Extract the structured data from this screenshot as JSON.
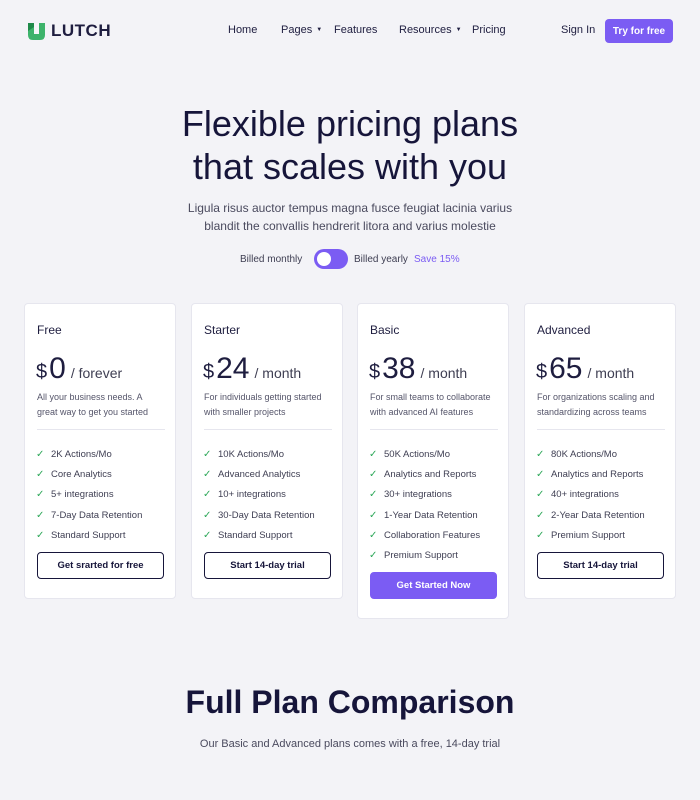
{
  "brand": {
    "name": "LUTCH",
    "logo_icon": "lutch-logo-icon",
    "accent_color": "#7b5cf3"
  },
  "nav": {
    "links": [
      {
        "label": "Home",
        "has_dropdown": false
      },
      {
        "label": "Pages",
        "has_dropdown": true
      },
      {
        "label": "Features",
        "has_dropdown": false
      },
      {
        "label": "Resources",
        "has_dropdown": true
      },
      {
        "label": "Pricing",
        "has_dropdown": false
      }
    ],
    "sign_in": "Sign In",
    "cta": "Try for free"
  },
  "hero": {
    "title_line1": "Flexible pricing plans",
    "title_line2": "that scales with you",
    "subtitle_line1": "Ligula risus auctor tempus magna fusce feugiat lacinia varius",
    "subtitle_line2": "blandit the convallis hendrerit litora and varius molestie"
  },
  "billing": {
    "monthly_label": "Billed monthly",
    "yearly_label": "Billed yearly",
    "save_label": "Save 15%",
    "toggle_on": true
  },
  "plans": [
    {
      "name": "Free",
      "currency": "$",
      "price": "0",
      "period": "/ forever",
      "desc_line1": "All your business needs. A",
      "desc_line2": "great way to get you started",
      "features": [
        "2K Actions/Mo",
        "Core Analytics",
        "5+ integrations",
        "7-Day Data Retention",
        "Standard Support"
      ],
      "cta": "Get srarted for free"
    },
    {
      "name": "Starter",
      "currency": "$",
      "price": "24",
      "period": "/ month",
      "desc_line1": "For individuals getting started",
      "desc_line2": "with smaller projects",
      "features": [
        "10K Actions/Mo",
        "Advanced Analytics",
        "10+ integrations",
        "30-Day Data Retention",
        "Standard Support"
      ],
      "cta": "Start 14-day trial"
    },
    {
      "name": "Basic",
      "currency": "$",
      "price": "38",
      "period": "/ month",
      "desc_line1": "For small teams to collaborate",
      "desc_line2": "with advanced AI features",
      "features": [
        "50K Actions/Mo",
        "Analytics and Reports",
        "30+ integrations",
        "1-Year Data Retention",
        "Collaboration Features",
        "Premium Support"
      ],
      "cta": "Get Started Now"
    },
    {
      "name": "Advanced",
      "currency": "$",
      "price": "65",
      "period": "/ month",
      "desc_line1": "For organizations scaling and",
      "desc_line2": "standardizing across teams",
      "features": [
        "80K Actions/Mo",
        "Analytics and Reports",
        "40+ integrations",
        "2-Year Data Retention",
        "Premium Support"
      ],
      "cta": "Start 14-day trial"
    }
  ],
  "comparison": {
    "title": "Full Plan Comparison",
    "subtitle": "Our Basic and Advanced plans comes with a free, 14-day trial"
  }
}
